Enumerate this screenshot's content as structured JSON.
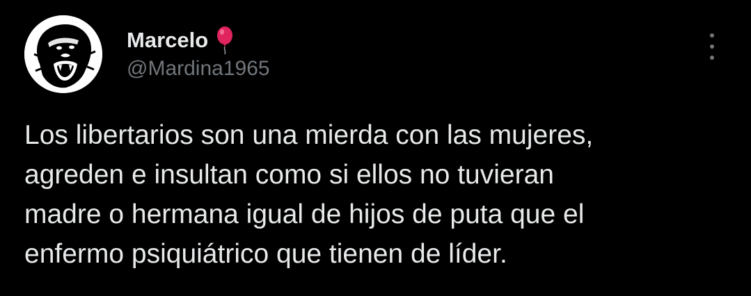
{
  "author": {
    "display_name": "Marcelo",
    "handle": "@Mardina1965",
    "avatar_icon": "gorilla-avatar",
    "name_emoji_icon": "red-balloon-icon"
  },
  "menu": {
    "icon": "more-options-icon"
  },
  "tweet": {
    "lines": [
      "Los libertarios son una mierda con las mujeres,",
      "agreden e insultan como si ellos no tuvieran",
      "madre o hermana igual de hijos de puta que el",
      "enfermo psiquiátrico que tienen de líder."
    ]
  },
  "colors": {
    "background": "#000000",
    "primary_text": "#e7e9ea",
    "secondary_text": "#71767b",
    "balloon": "#e0245e"
  }
}
